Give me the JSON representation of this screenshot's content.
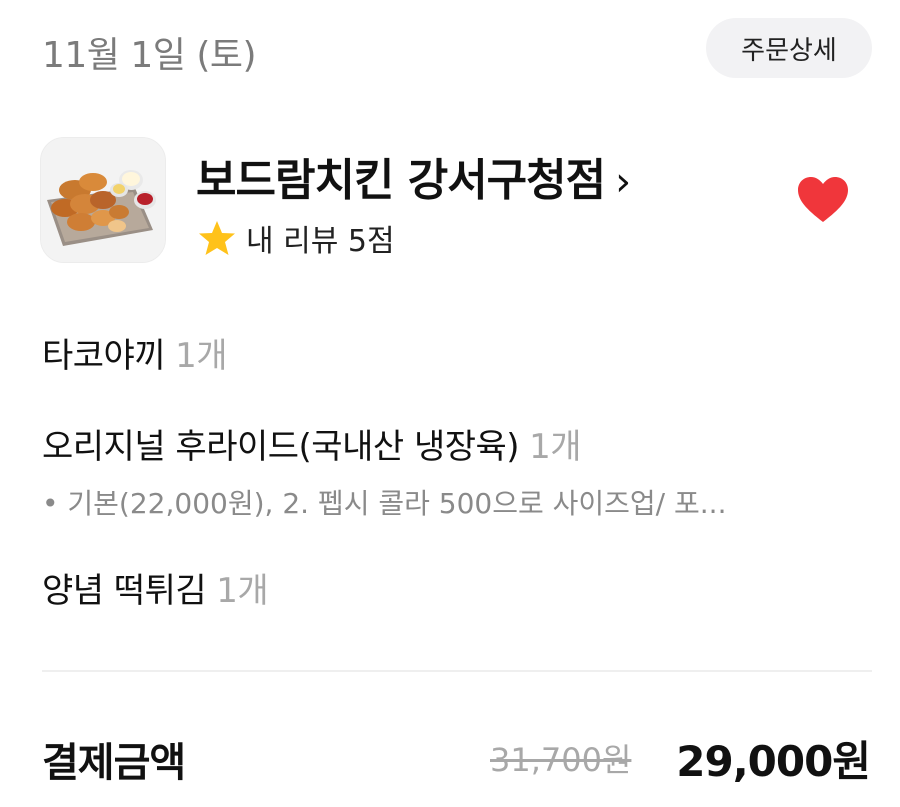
{
  "header": {
    "order_date": "11월 1일 (토)",
    "details_button": "주문상세"
  },
  "store": {
    "name": "보드람치킨 강서구청점",
    "chevron": "›",
    "favorited": true,
    "review_label": "내 리뷰 5점",
    "icons": {
      "thumbnail": "chicken-food-photo",
      "favorite": "heart-icon",
      "rating": "star-icon"
    },
    "colors": {
      "heart": "#f0363b",
      "star": "#ffc21a"
    }
  },
  "items": [
    {
      "name": "타코야끼",
      "qty": "1개"
    },
    {
      "name": "오리지널 후라이드(국내산 냉장육)",
      "qty": "1개",
      "option": "• 기본(22,000원), 2. 펩시 콜라 500으로 사이즈업/ 포..."
    },
    {
      "name": "양념 떡튀김",
      "qty": "1개"
    }
  ],
  "payment": {
    "label": "결제금액",
    "original_price": "31,700원",
    "final_price": "29,000원"
  }
}
